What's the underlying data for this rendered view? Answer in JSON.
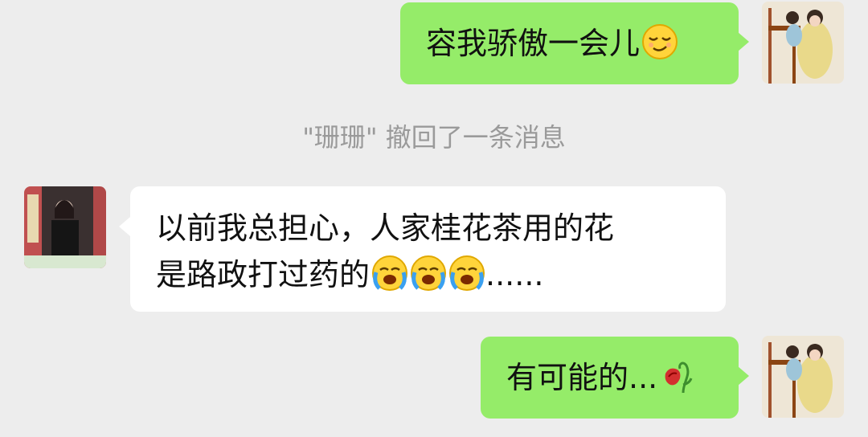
{
  "messages": [
    {
      "side": "right",
      "text": "容我骄傲一会儿",
      "emoji": "smirk-face-icon"
    },
    {
      "side": "system",
      "text": "\"珊珊\" 撤回了一条消息"
    },
    {
      "side": "left",
      "line1": "以前我总担心，人家桂花茶用的花",
      "line2": "是路政打过药的",
      "emoji": "loudly-crying-face-icon",
      "suffix": "......"
    },
    {
      "side": "right",
      "text": "有可能的...",
      "emoji": "wilted-rose-icon"
    }
  ],
  "colors": {
    "background": "#ededed",
    "my_bubble": "#95ec69",
    "their_bubble": "#ffffff",
    "system_text": "#9a9a9a"
  }
}
